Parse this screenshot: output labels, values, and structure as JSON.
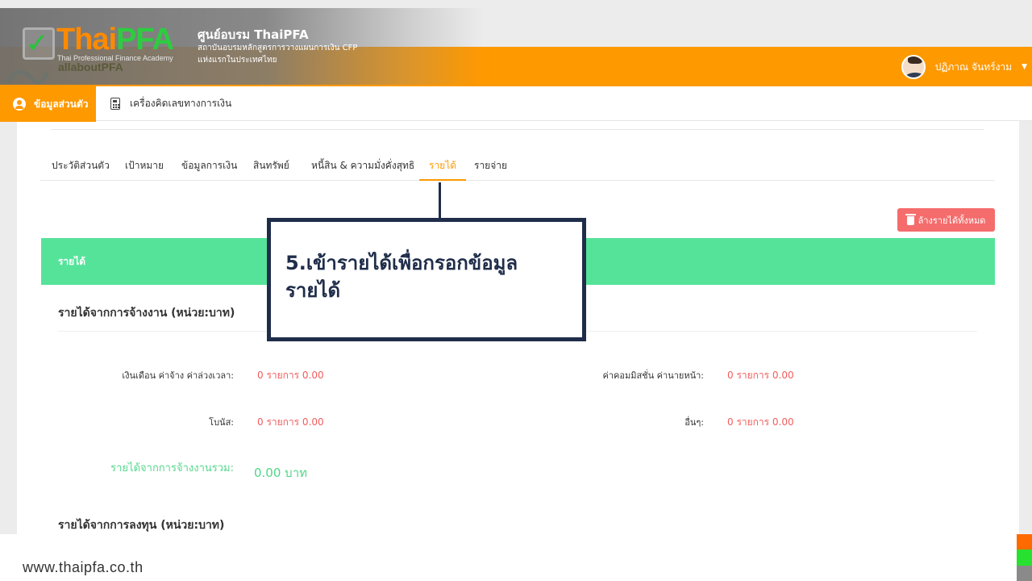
{
  "header": {
    "logo_text_a": "Thai",
    "logo_text_b": "PFA",
    "logo_tagline": "Thai Professional Finance Academy",
    "ghost_brand": "allaboutPFA",
    "org_title": "ศูนย์อบรม ThaiPFA",
    "org_subtitle_1": "สถาบันอบรมหลักสูตรการวางแผนการเงิน CFP",
    "org_subtitle_2": "แห่งแรกในประเทศไทย",
    "user_name": "ปฏิภาณ จันทร์งาม",
    "user_caret_icon": "caret-down-icon"
  },
  "nav": {
    "profile_label": "ข้อมูลส่วนตัว",
    "calculator_label": "เครื่องคิดเลขทางการเงิน"
  },
  "tabs": [
    {
      "label": "ประวัติส่วนตัว"
    },
    {
      "label": "เป้าหมาย"
    },
    {
      "label": "ข้อมูลการเงิน"
    },
    {
      "label": "สินทรัพย์"
    },
    {
      "label": "หนี้สิน & ความมั่งคั่งสุทธิ"
    },
    {
      "label": "รายได้",
      "active": true
    },
    {
      "label": "รายจ่าย"
    }
  ],
  "clear_button_label": "ล้างรายได้ทั้งหมด",
  "section_title": "รายได้",
  "employment": {
    "heading": "รายได้จากการจ้างงาน (หน่วย:บาท)",
    "rows": [
      {
        "label": "เงินเดือน ค่าจ้าง ค่าล่วงเวลา:",
        "value": "0 รายการ 0.00"
      },
      {
        "label": "ค่าคอมมิสชั่น ค่านายหน้า:",
        "value": "0 รายการ 0.00"
      },
      {
        "label": "โบนัส:",
        "value": "0 รายการ 0.00"
      },
      {
        "label": "อื่นๆ:",
        "value": "0 รายการ 0.00"
      }
    ],
    "total_label": "รายได้จากการจ้างงานรวม:",
    "total_value": "0.00 บาท"
  },
  "investment": {
    "heading": "รายได้จากการลงทุน (หน่วย:บาท)"
  },
  "annotation": {
    "line1": "5.เข้ารายได้เพื่อกรอกข้อมูล",
    "line2": "รายได้"
  },
  "footer": {
    "url": "www.thaipfa.co.th"
  },
  "colors": {
    "primary_orange": "#ff9900",
    "section_green": "#55e39a",
    "value_red": "#f25d5d",
    "total_green": "#55d98d",
    "annotation_navy": "#1f2d4a",
    "clear_button": "#f56c6c"
  }
}
